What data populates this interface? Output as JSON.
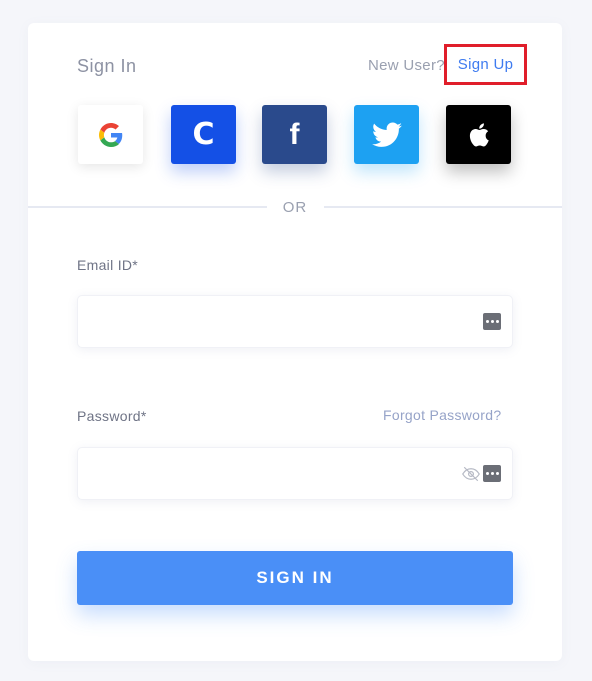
{
  "header": {
    "title": "Sign In",
    "new_user_text": "New User?",
    "signup_label": "Sign Up"
  },
  "social": {
    "items": [
      {
        "name": "google",
        "icon": "google-icon",
        "color": "#ffffff"
      },
      {
        "name": "c",
        "icon": "c-icon",
        "glyph": "C",
        "color": "#1450e6"
      },
      {
        "name": "facebook",
        "icon": "facebook-icon",
        "glyph": "f",
        "color": "#2a4a8c"
      },
      {
        "name": "twitter",
        "icon": "twitter-icon",
        "color": "#1da1f2"
      },
      {
        "name": "apple",
        "icon": "apple-icon",
        "color": "#000000"
      }
    ]
  },
  "divider": {
    "text": "OR"
  },
  "form": {
    "email_label": "Email ID*",
    "email_value": "",
    "email_placeholder": "",
    "password_label": "Password*",
    "password_value": "",
    "password_placeholder": "",
    "forgot_label": "Forgot Password?",
    "submit_label": "SIGN IN"
  },
  "colors": {
    "accent": "#4a8ff7",
    "link": "#3e7bf0",
    "highlight_border": "#e01e2a"
  }
}
